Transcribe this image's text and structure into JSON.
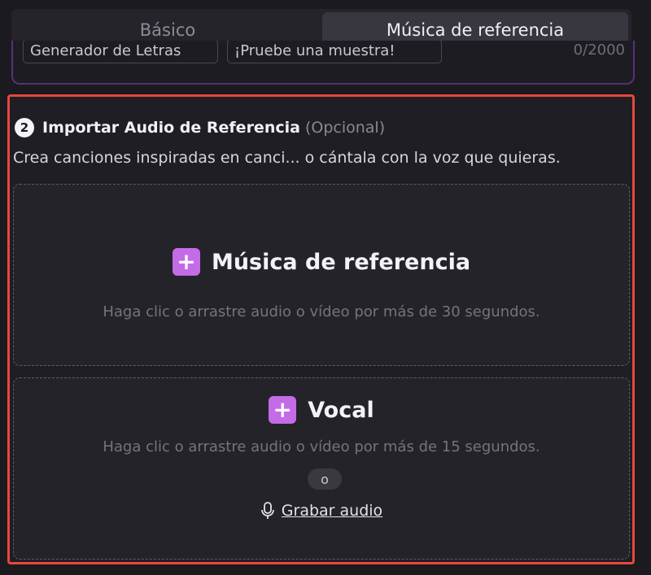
{
  "tabs": {
    "basic": "Básico",
    "reference": "Música de referencia"
  },
  "lyrics": {
    "chip_generator": "Generador de Letras",
    "chip_sample": "¡Pruebe una muestra!",
    "counter": "0/2000"
  },
  "section": {
    "step": "2",
    "title": "Importar Audio de Referencia",
    "optional": "(Opcional)",
    "description": "Crea canciones inspiradas en canci... o cántala con la voz que quieras."
  },
  "reference_zone": {
    "plus": "+",
    "title": "Música de referencia",
    "hint": "Haga clic o arrastre audio o vídeo por más de 30 segundos."
  },
  "vocal_zone": {
    "plus": "+",
    "title": "Vocal",
    "hint": "Haga clic o arrastre audio o vídeo por más de 15 segundos.",
    "or": "o",
    "record": "Grabar audio"
  },
  "colors": {
    "accent": "#c46be8",
    "highlight_border": "#e8473e"
  },
  "icons": [
    "plus-icon",
    "microphone-icon"
  ]
}
